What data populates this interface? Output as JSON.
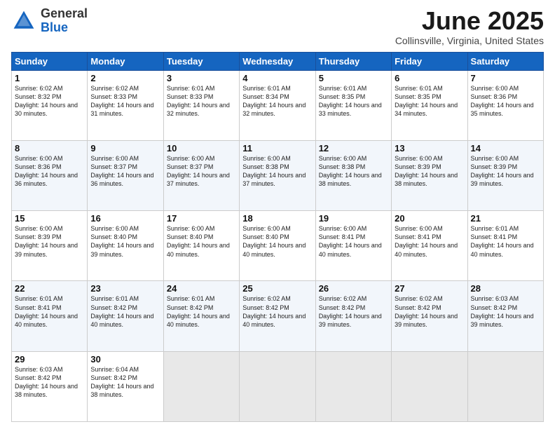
{
  "header": {
    "logo_general": "General",
    "logo_blue": "Blue",
    "title": "June 2025",
    "location": "Collinsville, Virginia, United States"
  },
  "days_of_week": [
    "Sunday",
    "Monday",
    "Tuesday",
    "Wednesday",
    "Thursday",
    "Friday",
    "Saturday"
  ],
  "weeks": [
    [
      {
        "day": 1,
        "sunrise": "6:02 AM",
        "sunset": "8:32 PM",
        "daylight": "14 hours and 30 minutes."
      },
      {
        "day": 2,
        "sunrise": "6:02 AM",
        "sunset": "8:33 PM",
        "daylight": "14 hours and 31 minutes."
      },
      {
        "day": 3,
        "sunrise": "6:01 AM",
        "sunset": "8:33 PM",
        "daylight": "14 hours and 32 minutes."
      },
      {
        "day": 4,
        "sunrise": "6:01 AM",
        "sunset": "8:34 PM",
        "daylight": "14 hours and 32 minutes."
      },
      {
        "day": 5,
        "sunrise": "6:01 AM",
        "sunset": "8:35 PM",
        "daylight": "14 hours and 33 minutes."
      },
      {
        "day": 6,
        "sunrise": "6:01 AM",
        "sunset": "8:35 PM",
        "daylight": "14 hours and 34 minutes."
      },
      {
        "day": 7,
        "sunrise": "6:00 AM",
        "sunset": "8:36 PM",
        "daylight": "14 hours and 35 minutes."
      }
    ],
    [
      {
        "day": 8,
        "sunrise": "6:00 AM",
        "sunset": "8:36 PM",
        "daylight": "14 hours and 36 minutes."
      },
      {
        "day": 9,
        "sunrise": "6:00 AM",
        "sunset": "8:37 PM",
        "daylight": "14 hours and 36 minutes."
      },
      {
        "day": 10,
        "sunrise": "6:00 AM",
        "sunset": "8:37 PM",
        "daylight": "14 hours and 37 minutes."
      },
      {
        "day": 11,
        "sunrise": "6:00 AM",
        "sunset": "8:38 PM",
        "daylight": "14 hours and 37 minutes."
      },
      {
        "day": 12,
        "sunrise": "6:00 AM",
        "sunset": "8:38 PM",
        "daylight": "14 hours and 38 minutes."
      },
      {
        "day": 13,
        "sunrise": "6:00 AM",
        "sunset": "8:39 PM",
        "daylight": "14 hours and 38 minutes."
      },
      {
        "day": 14,
        "sunrise": "6:00 AM",
        "sunset": "8:39 PM",
        "daylight": "14 hours and 39 minutes."
      }
    ],
    [
      {
        "day": 15,
        "sunrise": "6:00 AM",
        "sunset": "8:39 PM",
        "daylight": "14 hours and 39 minutes."
      },
      {
        "day": 16,
        "sunrise": "6:00 AM",
        "sunset": "8:40 PM",
        "daylight": "14 hours and 39 minutes."
      },
      {
        "day": 17,
        "sunrise": "6:00 AM",
        "sunset": "8:40 PM",
        "daylight": "14 hours and 40 minutes."
      },
      {
        "day": 18,
        "sunrise": "6:00 AM",
        "sunset": "8:40 PM",
        "daylight": "14 hours and 40 minutes."
      },
      {
        "day": 19,
        "sunrise": "6:00 AM",
        "sunset": "8:41 PM",
        "daylight": "14 hours and 40 minutes."
      },
      {
        "day": 20,
        "sunrise": "6:00 AM",
        "sunset": "8:41 PM",
        "daylight": "14 hours and 40 minutes."
      },
      {
        "day": 21,
        "sunrise": "6:01 AM",
        "sunset": "8:41 PM",
        "daylight": "14 hours and 40 minutes."
      }
    ],
    [
      {
        "day": 22,
        "sunrise": "6:01 AM",
        "sunset": "8:41 PM",
        "daylight": "14 hours and 40 minutes."
      },
      {
        "day": 23,
        "sunrise": "6:01 AM",
        "sunset": "8:42 PM",
        "daylight": "14 hours and 40 minutes."
      },
      {
        "day": 24,
        "sunrise": "6:01 AM",
        "sunset": "8:42 PM",
        "daylight": "14 hours and 40 minutes."
      },
      {
        "day": 25,
        "sunrise": "6:02 AM",
        "sunset": "8:42 PM",
        "daylight": "14 hours and 40 minutes."
      },
      {
        "day": 26,
        "sunrise": "6:02 AM",
        "sunset": "8:42 PM",
        "daylight": "14 hours and 39 minutes."
      },
      {
        "day": 27,
        "sunrise": "6:02 AM",
        "sunset": "8:42 PM",
        "daylight": "14 hours and 39 minutes."
      },
      {
        "day": 28,
        "sunrise": "6:03 AM",
        "sunset": "8:42 PM",
        "daylight": "14 hours and 39 minutes."
      }
    ],
    [
      {
        "day": 29,
        "sunrise": "6:03 AM",
        "sunset": "8:42 PM",
        "daylight": "14 hours and 38 minutes."
      },
      {
        "day": 30,
        "sunrise": "6:04 AM",
        "sunset": "8:42 PM",
        "daylight": "14 hours and 38 minutes."
      },
      null,
      null,
      null,
      null,
      null
    ]
  ]
}
